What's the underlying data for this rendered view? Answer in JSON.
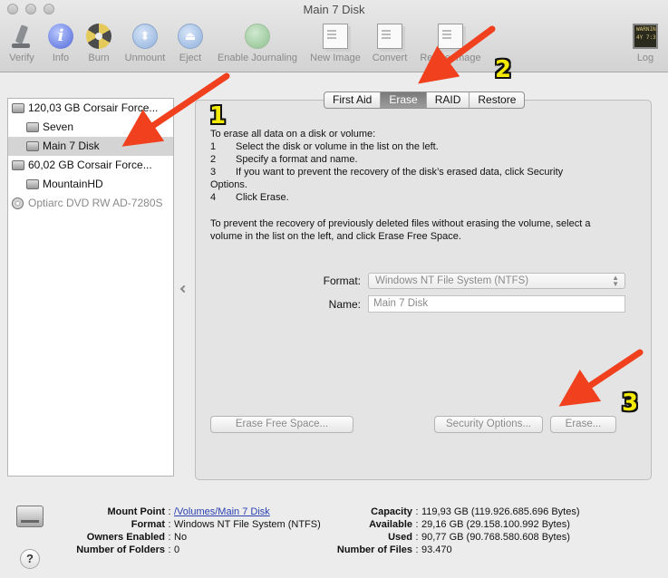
{
  "window": {
    "title": "Main 7 Disk"
  },
  "toolbar": {
    "items": [
      {
        "label": "Verify",
        "icon": "microscope-icon"
      },
      {
        "label": "Info",
        "icon": "info-icon"
      },
      {
        "label": "Burn",
        "icon": "burn-icon"
      },
      {
        "label": "Unmount",
        "icon": "unmount-icon"
      },
      {
        "label": "Eject",
        "icon": "eject-icon"
      },
      {
        "label": "Enable Journaling",
        "icon": "journaling-icon"
      },
      {
        "label": "New Image",
        "icon": "new-image-icon"
      },
      {
        "label": "Convert",
        "icon": "convert-icon"
      },
      {
        "label": "Resize Image",
        "icon": "resize-image-icon"
      },
      {
        "label": "Log",
        "icon": "log-icon"
      }
    ],
    "log_icon_text": "WARNIN\n4Y 7:36"
  },
  "sidebar": {
    "items": [
      {
        "label": "120,03 GB Corsair Force...",
        "level": 0,
        "type": "disk"
      },
      {
        "label": "Seven",
        "level": 1,
        "type": "volume"
      },
      {
        "label": "Main 7 Disk",
        "level": 1,
        "type": "volume",
        "selected": true
      },
      {
        "label": "60,02 GB Corsair Force...",
        "level": 0,
        "type": "disk"
      },
      {
        "label": "MountainHD",
        "level": 1,
        "type": "volume"
      },
      {
        "label": "Optiarc DVD RW AD-7280S",
        "level": 0,
        "type": "optical"
      }
    ]
  },
  "tabs": [
    {
      "label": "First Aid",
      "active": false
    },
    {
      "label": "Erase",
      "active": true
    },
    {
      "label": "RAID",
      "active": false
    },
    {
      "label": "Restore",
      "active": false
    }
  ],
  "erase": {
    "intro": "To erase all data on a disk or volume:",
    "steps": [
      {
        "num": "1",
        "text": "Select the disk or volume in the list on the left."
      },
      {
        "num": "2",
        "text": "Specify a format and name."
      },
      {
        "num": "3",
        "text": "If you want to prevent the recovery of the disk’s erased data, click Security"
      },
      {
        "num": "",
        "text": "Options."
      },
      {
        "num": "4",
        "text": "Click Erase."
      }
    ],
    "free_space_line1": "To prevent the recovery of previously deleted files without erasing the volume, select a",
    "free_space_line2": "volume in the list on the left, and click Erase Free Space.",
    "format_label": "Format:",
    "format_value": "Windows NT File System (NTFS)",
    "name_label": "Name:",
    "name_value": "Main 7 Disk",
    "erase_free_space_button": "Erase Free Space...",
    "security_options_button": "Security Options...",
    "erase_button": "Erase..."
  },
  "info": {
    "left": [
      {
        "key": "Mount Point",
        "value": "/Volumes/Main 7 Disk",
        "link": true
      },
      {
        "key": "Format",
        "value": "Windows NT File System (NTFS)"
      },
      {
        "key": "Owners Enabled",
        "value": "No"
      },
      {
        "key": "Number of Folders",
        "value": "0"
      }
    ],
    "right": [
      {
        "key": "Capacity",
        "value": "119,93 GB (119.926.685.696 Bytes)"
      },
      {
        "key": "Available",
        "value": "29,16 GB (29.158.100.992 Bytes)"
      },
      {
        "key": "Used",
        "value": "90,77 GB (90.768.580.608 Bytes)"
      },
      {
        "key": "Number of Files",
        "value": "93.470"
      }
    ],
    "help_label": "?"
  },
  "annotations": {
    "colors": {
      "arrow": "#f0401e",
      "number": "#f4e900"
    },
    "numbers": [
      "1",
      "2",
      "3"
    ]
  }
}
